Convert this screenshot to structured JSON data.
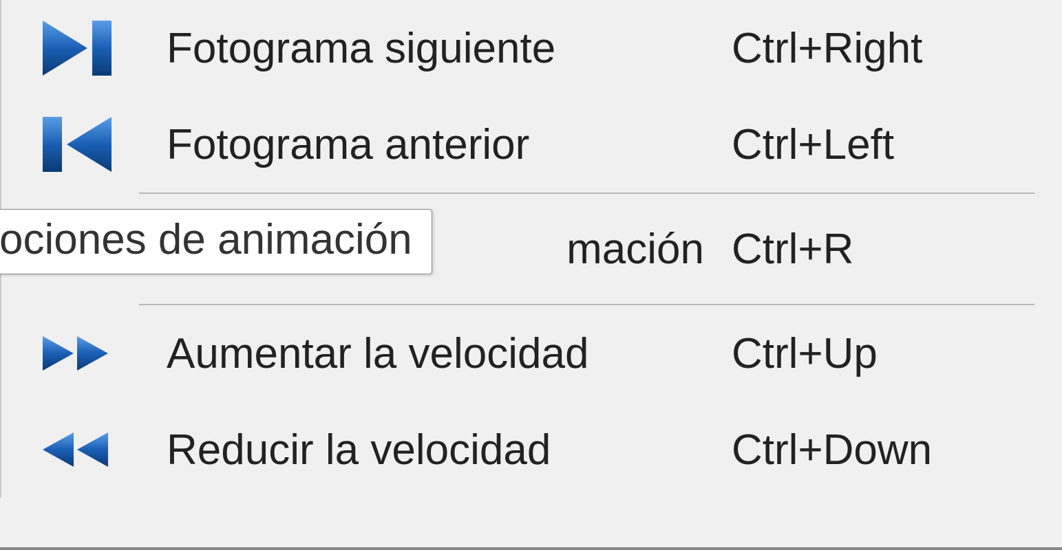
{
  "tooltip": {
    "text": "ociones de animación"
  },
  "menu": {
    "items": [
      {
        "label": "Fotograma siguiente",
        "shortcut": "Ctrl+Right"
      },
      {
        "label": "Fotograma anterior",
        "shortcut": "Ctrl+Left"
      },
      {
        "label": "mación",
        "shortcut": "Ctrl+R"
      },
      {
        "label": "Aumentar la velocidad",
        "shortcut": "Ctrl+Up"
      },
      {
        "label": "Reducir la velocidad",
        "shortcut": "Ctrl+Down"
      }
    ]
  }
}
